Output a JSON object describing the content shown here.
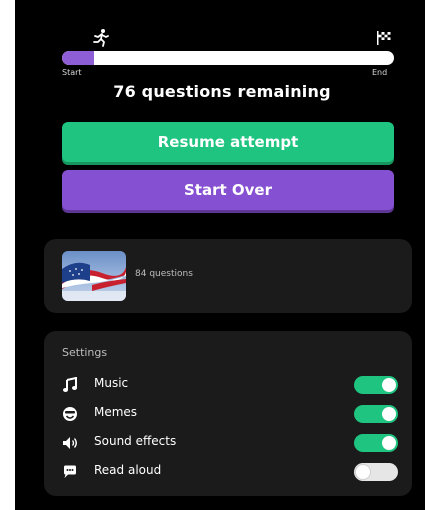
{
  "progress": {
    "start_label": "Start",
    "end_label": "End",
    "fraction_complete": 0.095,
    "remaining_text": "76 questions remaining",
    "fill_color": "#8e5ed6"
  },
  "buttons": {
    "resume_label": "Resume attempt",
    "start_over_label": "Start Over",
    "resume_color": "#1ec47f",
    "start_over_color": "#8550d1"
  },
  "quiz": {
    "question_count": "84 questions",
    "thumbnail_icon": "american-flag-image"
  },
  "settings": {
    "title": "Settings",
    "items": [
      {
        "label": "Music",
        "icon": "music-note-icon",
        "enabled": true
      },
      {
        "label": "Memes",
        "icon": "meme-face-icon",
        "enabled": true
      },
      {
        "label": "Sound effects",
        "icon": "speaker-icon",
        "enabled": true
      },
      {
        "label": "Read aloud",
        "icon": "speech-bubble-icon",
        "enabled": false
      }
    ]
  }
}
